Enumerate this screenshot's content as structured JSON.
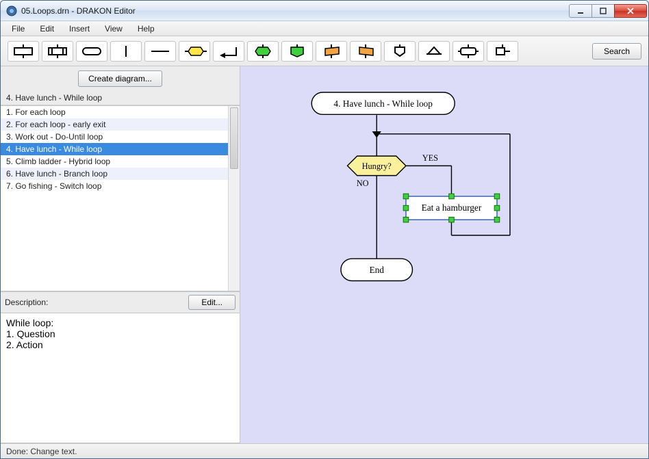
{
  "window": {
    "title": "05.Loops.drn - DRAKON Editor"
  },
  "menu": {
    "file": "File",
    "edit": "Edit",
    "insert": "Insert",
    "view": "View",
    "help": "Help"
  },
  "toolbar": {
    "search": "Search",
    "icons": [
      "action-box",
      "insertion-box",
      "terminator-box",
      "vline",
      "hline",
      "question-diamond",
      "arrow-left",
      "branch-cap-green",
      "branch-green",
      "orange-process",
      "orange-process-rev",
      "branch-small",
      "branch-angle",
      "for-loop",
      "address-box"
    ]
  },
  "sidebar": {
    "create": "Create diagram...",
    "current": "4. Have lunch - While loop",
    "items": [
      "1. For each loop",
      "2. For each loop - early exit",
      "3. Work out - Do-Until loop",
      "4. Have lunch - While loop",
      "5. Climb ladder - Hybrid loop",
      "6. Have lunch - Branch loop",
      "7. Go fishing - Switch loop"
    ],
    "selected_index": 3
  },
  "description": {
    "label": "Description:",
    "edit": "Edit...",
    "text": "While loop:\n1. Question\n2. Action"
  },
  "diagram": {
    "title": "4. Have lunch - While loop",
    "question": "Hungry?",
    "yes": "YES",
    "no": "NO",
    "action": "Eat a hamburger",
    "end": "End"
  },
  "status": "Done: Change text."
}
